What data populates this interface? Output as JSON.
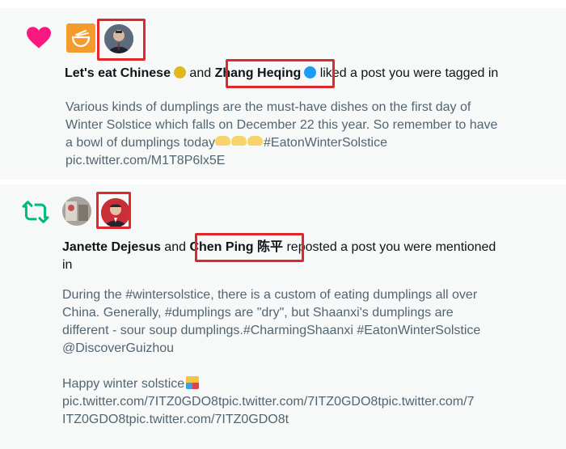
{
  "notifications": [
    {
      "type": "like",
      "icon": "heart-icon",
      "icon_color": "#f91880",
      "actor1": "Let's eat Chinese",
      "actor1_badge": "gold",
      "joiner": "and",
      "actor2": "Zhang Heqing",
      "actor2_badge": "blue",
      "action": "liked a post you were tagged in",
      "body_lines": [
        "Various kinds of dumplings are the must-have dishes on the first day of",
        "Winter Solstice which falls on December 22 this year. So remember to have",
        "a bowl of dumplings today",
        "#EatonWinterSolstice",
        "pic.twitter.com/M1T8P6lx5E"
      ]
    },
    {
      "type": "repost",
      "icon": "repost-icon",
      "icon_color": "#00ba7c",
      "actor1": "Janette Dejesus",
      "joiner": "and",
      "actor2": "Chen Ping 陈平",
      "action": "reposted a post you were mentioned",
      "action_cont": "in",
      "body_lines": [
        "During the #wintersolstice, there is a custom of eating dumplings all over",
        "China. Generally, #dumplings are \"dry\", but Shaanxi's dumplings are",
        "different - sour soup dumplings.#CharmingShaanxi #EatonWinterSolstice",
        "@DiscoverGuizhou",
        "Happy winter solstice",
        "pic.twitter.com/7ITZ0GDO8tpic.twitter.com/7ITZ0GDO8tpic.twitter.com/7",
        "ITZ0GDO8tpic.twitter.com/7ITZ0GDO8t"
      ]
    }
  ],
  "colors": {
    "highlight_box": "#e0282c",
    "card_bg": "#f7f9f9",
    "verified_gold": "#e2b719",
    "verified_blue": "#1d9bf0"
  }
}
